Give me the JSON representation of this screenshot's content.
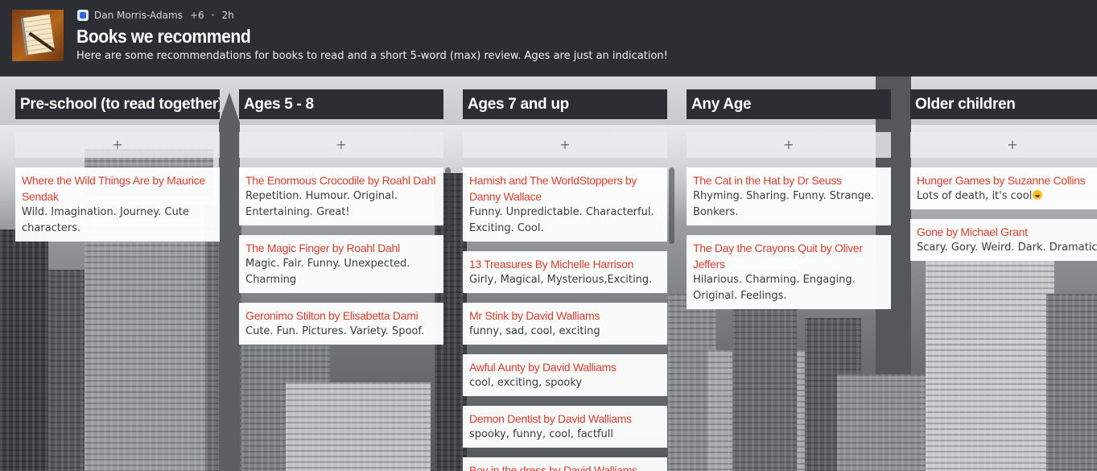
{
  "header": {
    "author": "Dan Morris-Adams",
    "contributors": "+6",
    "time": "2h",
    "title": "Books we recommend",
    "description": "Here are some recommendations for books to read and a short 5-word (max) review. Ages are just an indication!"
  },
  "add_label": "+",
  "columns": [
    {
      "title": "Pre-school (to read together)",
      "cards": [
        {
          "title": "Where the Wild Things Are by Maurice Sendak",
          "body": "Wild. Imagination. Journey. Cute characters."
        }
      ]
    },
    {
      "title": "Ages 5 - 8",
      "cards": [
        {
          "title": "The Enormous Crocodile by Roahl Dahl",
          "body": "Repetition. Humour. Original. Entertaining. Great!"
        },
        {
          "title": "The Magic Finger by Roahl Dahl",
          "body": "Magic. Fair. Funny. Unexpected. Charming"
        },
        {
          "title": "Geronimo Stilton by Elisabetta Dami",
          "body": "Cute. Fun. Pictures. Variety. Spoof."
        }
      ]
    },
    {
      "title": "Ages 7 and up",
      "cards": [
        {
          "title": "Hamish and The WorldStoppers by Danny Wallace",
          "body": "Funny. Unpredictable. Characterful. Exciting. Cool."
        },
        {
          "title": "13 Treasures By Michelle Harrison",
          "body": "Girly, Magical, Mysterious,Exciting."
        },
        {
          "title": "Mr Stink by David Walliams",
          "body": "funny, sad, cool, exciting"
        },
        {
          "title": "Awful Aunty by David Walliams",
          "body": "cool, exciting, spooky"
        },
        {
          "title": "Demon Dentist by David Walliams",
          "body": "spooky, funny, cool, factfull"
        },
        {
          "title": "Boy in the dress by David Walliams",
          "body": ""
        }
      ]
    },
    {
      "title": "Any Age",
      "cards": [
        {
          "title": "The Cat in the Hat by Dr Seuss",
          "body": "Rhyming. Sharing. Funny.  Strange. Bonkers."
        },
        {
          "title": "The Day the Crayons Quit by Oliver Jeffers",
          "body": "Hilarious. Charming. Engaging. Original. Feelings."
        }
      ]
    },
    {
      "title": "Older children",
      "cards": [
        {
          "title": "Hunger Games by Suzanne Collins",
          "body": "Lots of death, it's cool",
          "emoji": "grinning-emoji"
        },
        {
          "title": "Gone by Michael Grant",
          "body": "Scary. Gory. Weird. Dark. Dramatic"
        }
      ]
    }
  ]
}
